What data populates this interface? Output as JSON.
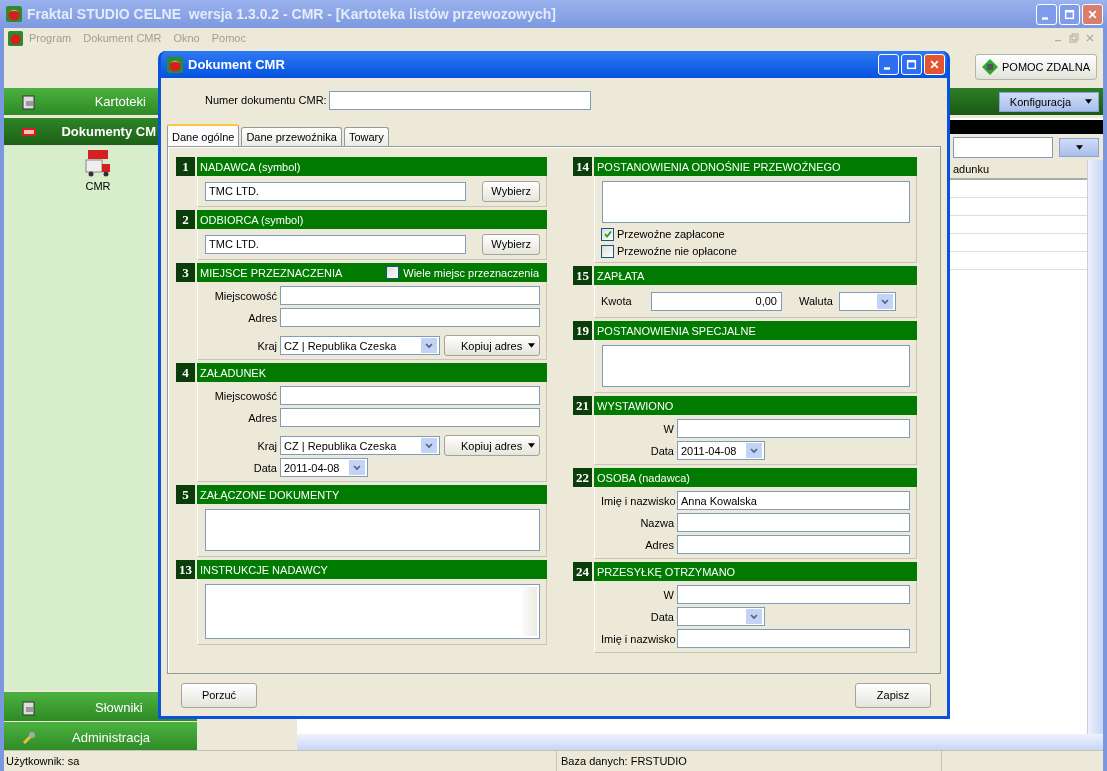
{
  "window": {
    "title": "Fraktal STUDIO CELNE  wersja 1.3.0.2 - CMR - [Kartoteka listów przewozowych]"
  },
  "menu": [
    {
      "label": "Program"
    },
    {
      "label": "Dokument CMR"
    },
    {
      "label": "Okno"
    },
    {
      "label": "Pomoc"
    }
  ],
  "remote_help_button": "POMOC ZDALNA",
  "config_button": "Konfiguracja",
  "sidebar": {
    "top_items": [
      {
        "label": "Kartoteki",
        "selected": false
      },
      {
        "label": "Dokumenty CM",
        "selected": true
      }
    ],
    "modules": [
      {
        "label": "CMR"
      }
    ],
    "bottom_items": [
      {
        "label": "Słowniki",
        "selected": false
      },
      {
        "label": "Administracja",
        "selected": false
      }
    ]
  },
  "list": {
    "columns": [
      {
        "label": "adunku"
      }
    ]
  },
  "status_bar": [
    {
      "text": "Użytkownik: sa"
    },
    {
      "text": "Baza danych: FRSTUDIO"
    }
  ],
  "dialog": {
    "title": "Dokument CMR",
    "number_label": "Numer dokumentu CMR:",
    "tabs": [
      {
        "label": "Dane ogólne",
        "selected": true
      },
      {
        "label": "Dane przewoźnika",
        "selected": false
      },
      {
        "label": "Towary",
        "selected": false
      }
    ],
    "left_sections": [
      {
        "number": "1",
        "title": "NADAWCA (symbol)",
        "rows": [
          {
            "kind": "pick",
            "value": "TMC LTD.",
            "button": "Wybierz"
          }
        ]
      },
      {
        "number": "2",
        "title": "ODBIORCA (symbol)",
        "rows": [
          {
            "kind": "pick",
            "value": "TMC LTD.",
            "button": "Wybierz"
          }
        ]
      },
      {
        "number": "3",
        "title": "MIEJSCE PRZEZNACZENIA",
        "header_checkbox": {
          "label": "Wiele miejsc przeznaczenia",
          "checked": false
        },
        "rows": [
          {
            "kind": "field",
            "label": "Miejscowość"
          },
          {
            "kind": "field",
            "label": "Adres"
          },
          {
            "kind": "country",
            "label": "Kraj",
            "value": "CZ | Republika Czeska",
            "button": "Kopiuj adres"
          }
        ]
      },
      {
        "number": "4",
        "title": "ZAŁADUNEK",
        "rows": [
          {
            "kind": "field",
            "label": "Miejscowość"
          },
          {
            "kind": "field",
            "label": "Adres"
          },
          {
            "kind": "country",
            "label": "Kraj",
            "value": "CZ | Republika Czeska",
            "button": "Kopiuj adres"
          },
          {
            "kind": "date",
            "label": "Data",
            "value": "2011-04-08"
          }
        ]
      },
      {
        "number": "5",
        "title": "ZAŁĄCZONE DOKUMENTY",
        "rows": [
          {
            "kind": "memo"
          }
        ]
      },
      {
        "number": "13",
        "title": "INSTRUKCJE NADAWCY",
        "rows": [
          {
            "kind": "memo_scroll"
          }
        ]
      }
    ],
    "right_sections": [
      {
        "number": "14",
        "title": "POSTANOWIENIA ODNOŚNIE PRZEWOŹNEGO",
        "rows": [
          {
            "kind": "memo"
          },
          {
            "kind": "checkbox",
            "label": "Przewoźne zapłacone",
            "checked": true
          },
          {
            "kind": "checkbox",
            "label": "Przewoźne nie opłacone",
            "checked": false
          }
        ]
      },
      {
        "number": "15",
        "title": "ZAPŁATA",
        "rows": [
          {
            "kind": "amount",
            "label": "Kwota",
            "value": "0,00",
            "currency_label": "Waluta"
          }
        ]
      },
      {
        "number": "19",
        "title": "POSTANOWIENIA SPECJALNE",
        "rows": [
          {
            "kind": "memo"
          }
        ]
      },
      {
        "number": "21",
        "title": "WYSTAWIONO",
        "rows": [
          {
            "kind": "field",
            "label": "W"
          },
          {
            "kind": "date",
            "label": "Data",
            "value": "2011-04-08"
          }
        ]
      },
      {
        "number": "22",
        "title": "OSOBA (nadawca)",
        "rows": [
          {
            "kind": "field",
            "label": "Imię i nazwisko",
            "value": "Anna Kowalska"
          },
          {
            "kind": "field",
            "label": "Nazwa"
          },
          {
            "kind": "field",
            "label": "Adres"
          }
        ]
      },
      {
        "number": "24",
        "title": "PRZESYŁKĘ OTRZYMANO",
        "rows": [
          {
            "kind": "field",
            "label": "W"
          },
          {
            "kind": "date",
            "label": "Data"
          },
          {
            "kind": "field",
            "label": "Imię i nazwisko"
          }
        ]
      }
    ],
    "buttons": [
      {
        "label": "Porzuć"
      },
      {
        "label": "Zapisz"
      }
    ]
  }
}
